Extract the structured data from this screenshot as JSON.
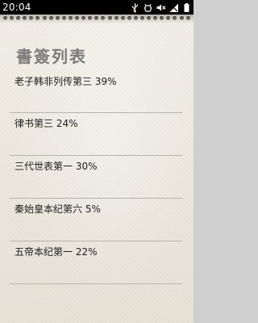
{
  "status_bar": {
    "time": "20:04",
    "icons": [
      "usb-icon",
      "usb-debug-icon",
      "mute-icon",
      "signal-crossed-icon",
      "battery-icon"
    ]
  },
  "page": {
    "title": "書簽列表"
  },
  "bookmarks": [
    {
      "label": "老子韩非列传第三 39%"
    },
    {
      "label": "律书第三 24%"
    },
    {
      "label": "三代世表第一 30%"
    },
    {
      "label": "秦始皇本纪第六 5%"
    },
    {
      "label": "五帝本纪第一 22%"
    }
  ],
  "colors": {
    "status_bar_bg": "#000000",
    "paper_bg": "#eeeae0",
    "title_color": "#7b7b7b",
    "item_text": "#1a1a1a",
    "divider": "#b8b5ad"
  }
}
